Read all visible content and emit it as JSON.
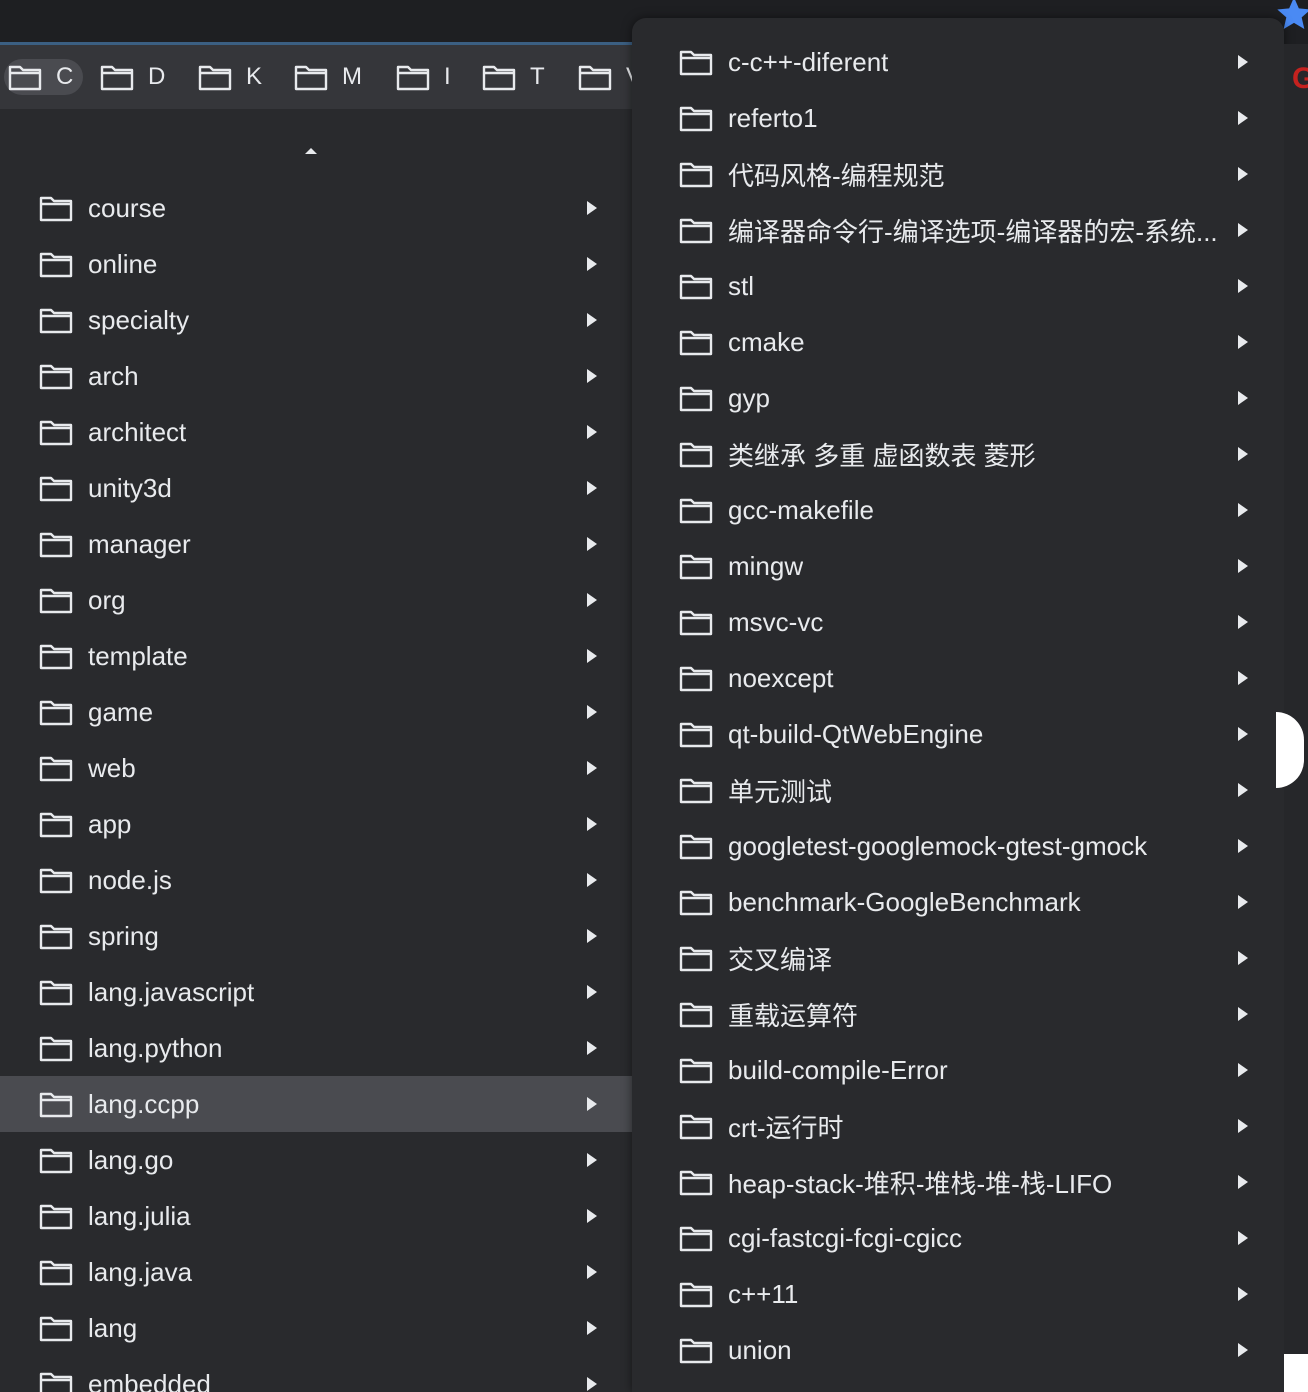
{
  "bookmarks_bar": {
    "folders": [
      {
        "label": "C",
        "active": true
      },
      {
        "label": "D"
      },
      {
        "label": "K"
      },
      {
        "label": "M"
      },
      {
        "label": "I"
      },
      {
        "label": "T"
      },
      {
        "label": "V"
      }
    ]
  },
  "left_menu": {
    "items": [
      {
        "label": "course"
      },
      {
        "label": "online"
      },
      {
        "label": "specialty"
      },
      {
        "label": "arch"
      },
      {
        "label": "architect"
      },
      {
        "label": "unity3d"
      },
      {
        "label": "manager"
      },
      {
        "label": "org"
      },
      {
        "label": "template"
      },
      {
        "label": "game"
      },
      {
        "label": "web"
      },
      {
        "label": "app"
      },
      {
        "label": "node.js"
      },
      {
        "label": "spring"
      },
      {
        "label": "lang.javascript"
      },
      {
        "label": "lang.python"
      },
      {
        "label": "lang.ccpp",
        "highlighted": true
      },
      {
        "label": "lang.go"
      },
      {
        "label": "lang.julia"
      },
      {
        "label": "lang.java"
      },
      {
        "label": "lang"
      },
      {
        "label": "embedded"
      }
    ]
  },
  "right_menu": {
    "items": [
      {
        "label": "c-c++-diferent"
      },
      {
        "label": "referto1"
      },
      {
        "label": "代码风格-编程规范"
      },
      {
        "label": "编译器命令行-编译选项-编译器的宏-系统..."
      },
      {
        "label": "stl"
      },
      {
        "label": "cmake"
      },
      {
        "label": "gyp"
      },
      {
        "label": " 类继承 多重  虚函数表  菱形"
      },
      {
        "label": "gcc-makefile"
      },
      {
        "label": "mingw"
      },
      {
        "label": "msvc-vc"
      },
      {
        "label": "noexcept"
      },
      {
        "label": "qt-build-QtWebEngine"
      },
      {
        "label": "单元测试"
      },
      {
        "label": "googletest-googlemock-gtest-gmock"
      },
      {
        "label": "benchmark-GoogleBenchmark"
      },
      {
        "label": "交叉编译"
      },
      {
        "label": "重载运算符"
      },
      {
        "label": "build-compile-Error"
      },
      {
        "label": "crt-运行时"
      },
      {
        "label": "heap-stack-堆积-堆栈-堆-栈-LIFO"
      },
      {
        "label": "cgi-fastcgi-fcgi-cgicc"
      },
      {
        "label": "c++11"
      },
      {
        "label": "union"
      }
    ]
  },
  "page_edge": {
    "letter": "G"
  },
  "colors": {
    "menu_bg": "#292a2d",
    "highlight_bg": "#4a4b50",
    "text": "#e8eaed",
    "star": "#4a8af4"
  }
}
